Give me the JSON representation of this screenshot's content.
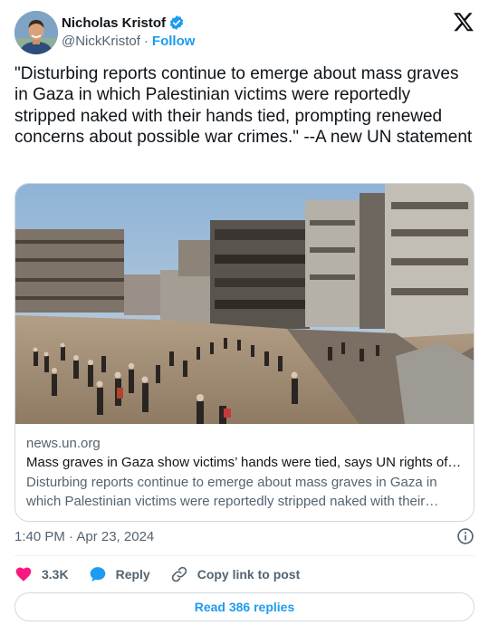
{
  "author": {
    "display_name": "Nicholas Kristof",
    "handle": "@NickKristof",
    "separator": "·",
    "follow_label": "Follow",
    "verified": true
  },
  "tweet": {
    "text": "\"Disturbing reports continue to emerge about mass graves in Gaza in which Palestinian victims were reportedly stripped naked with their hands tied, prompting renewed concerns about possible war crimes.\" --A new UN statement"
  },
  "card": {
    "domain": "news.un.org",
    "title": "Mass graves in Gaza show victims’ hands were tied, says UN rights office",
    "description": "Disturbing reports continue to emerge about mass graves in Gaza in which Palestinian victims were reportedly stripped naked with their hands tied, prompting renewed concerns about possible war crimes."
  },
  "meta": {
    "timestamp": "1:40 PM · Apr 23, 2024"
  },
  "actions": {
    "like_count": "3.3K",
    "reply_label": "Reply",
    "copy_label": "Copy link to post",
    "read_replies_label": "Read 386 replies"
  },
  "colors": {
    "accent": "#1d9bf0",
    "like": "#f91880",
    "secondary_text": "#536471",
    "border": "#cfd9de"
  },
  "icons": [
    "verified-badge-icon",
    "x-logo-icon",
    "info-icon",
    "heart-icon",
    "reply-bubble-icon",
    "link-icon"
  ]
}
